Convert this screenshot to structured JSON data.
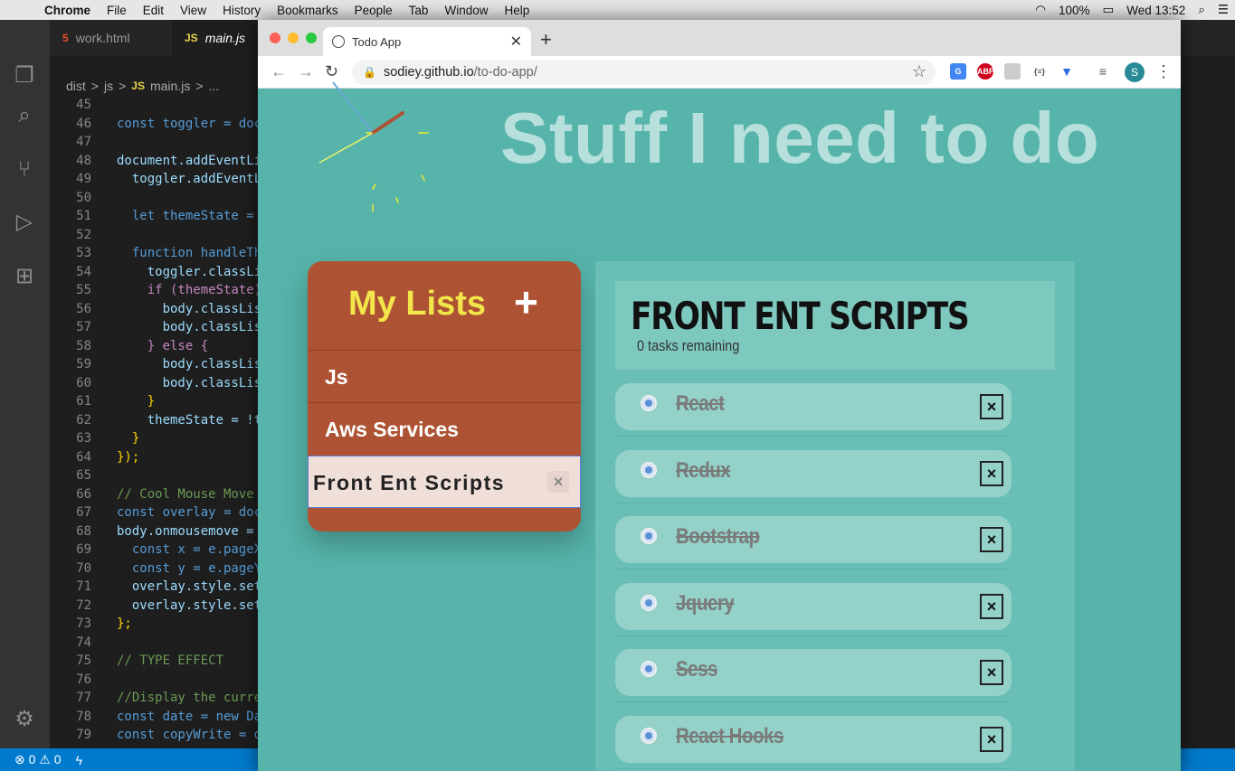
{
  "menubar": {
    "app": "Chrome",
    "items": [
      "File",
      "Edit",
      "View",
      "History",
      "Bookmarks",
      "People",
      "Tab",
      "Window",
      "Help"
    ],
    "battery": "100%",
    "clock": "Wed 13:52"
  },
  "vscode": {
    "tabs": [
      {
        "badge": "5",
        "label": "work.html"
      },
      {
        "badge": "JS",
        "label": "main.js"
      }
    ],
    "breadcrumb": [
      "dist",
      ">",
      "js",
      ">",
      "JS",
      "main.js",
      ">",
      "..."
    ],
    "code_lines": [
      {
        "n": "45",
        "t": ""
      },
      {
        "n": "46",
        "t": "const toggler = doc"
      },
      {
        "n": "47",
        "t": ""
      },
      {
        "n": "48",
        "t": "document.addEventLi"
      },
      {
        "n": "49",
        "t": "  toggler.addEventL"
      },
      {
        "n": "50",
        "t": ""
      },
      {
        "n": "51",
        "t": "  let themeState = "
      },
      {
        "n": "52",
        "t": ""
      },
      {
        "n": "53",
        "t": "  function handleTh"
      },
      {
        "n": "54",
        "t": "    toggler.classLi"
      },
      {
        "n": "55",
        "t": "    if (themeState)"
      },
      {
        "n": "56",
        "t": "      body.classLis"
      },
      {
        "n": "57",
        "t": "      body.classLis"
      },
      {
        "n": "58",
        "t": "    } else {"
      },
      {
        "n": "59",
        "t": "      body.classLis"
      },
      {
        "n": "60",
        "t": "      body.classLis"
      },
      {
        "n": "61",
        "t": "    }"
      },
      {
        "n": "62",
        "t": "    themeState = !t"
      },
      {
        "n": "63",
        "t": "  }"
      },
      {
        "n": "64",
        "t": "});"
      },
      {
        "n": "65",
        "t": ""
      },
      {
        "n": "66",
        "t": "// Cool Mouse Move "
      },
      {
        "n": "67",
        "t": "const overlay = doc"
      },
      {
        "n": "68",
        "t": "body.onmousemove = "
      },
      {
        "n": "69",
        "t": "  const x = e.pageX"
      },
      {
        "n": "70",
        "t": "  const y = e.pageY"
      },
      {
        "n": "71",
        "t": "  overlay.style.set"
      },
      {
        "n": "72",
        "t": "  overlay.style.set"
      },
      {
        "n": "73",
        "t": "};"
      },
      {
        "n": "74",
        "t": ""
      },
      {
        "n": "75",
        "t": "// TYPE EFFECT"
      },
      {
        "n": "76",
        "t": ""
      },
      {
        "n": "77",
        "t": "//Display the curre"
      },
      {
        "n": "78",
        "t": "const date = new Da"
      },
      {
        "n": "79",
        "t": "const copyWrite = d"
      }
    ],
    "status": {
      "errors": "0",
      "warnings": "0"
    }
  },
  "chrome": {
    "tab_title": "Todo App",
    "url_host": "sodiey.github.io",
    "url_path": "/to-do-app/",
    "profile_initial": "S"
  },
  "app": {
    "hero": "Stuff I need to do",
    "lists_title": "My Lists",
    "add_label": "+",
    "lists": [
      "Js",
      "Aws Services",
      "Front Ent Scripts"
    ],
    "active_list_index": 2,
    "delete_label": "×",
    "panel_title": "FRONT ENT SCRIPTS",
    "tasks_remaining": "0 tasks remaining",
    "tasks": [
      {
        "name": "React",
        "done": true
      },
      {
        "name": "Redux",
        "done": true
      },
      {
        "name": "Bootstrap",
        "done": true
      },
      {
        "name": "Jquery",
        "done": true
      },
      {
        "name": "Sess",
        "done": true
      },
      {
        "name": "React Hooks",
        "done": true
      }
    ],
    "task_delete_label": "×"
  }
}
